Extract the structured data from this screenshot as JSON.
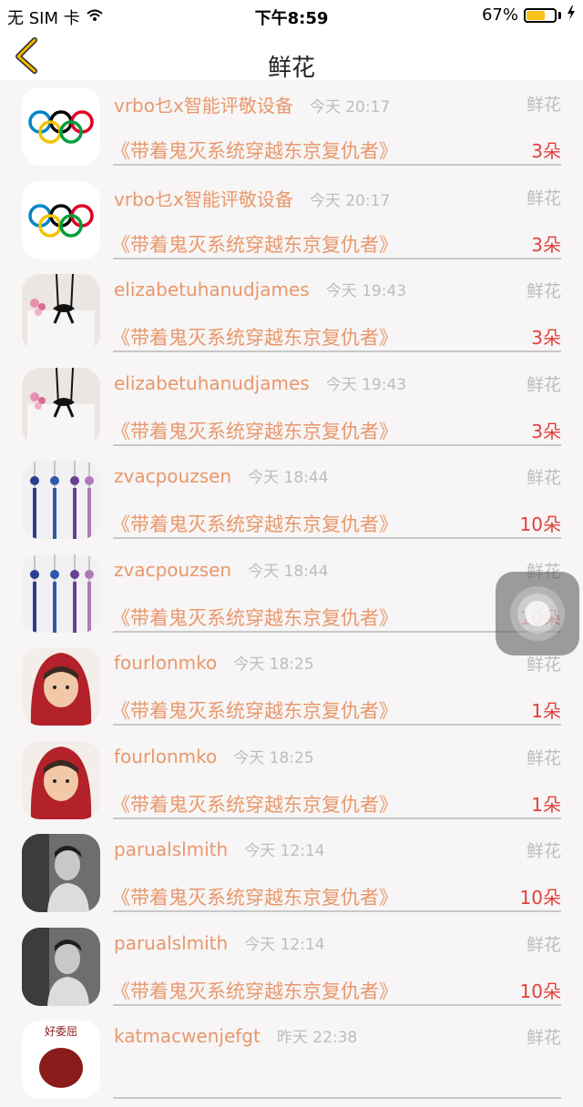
{
  "status": {
    "carrier": "无 SIM 卡",
    "time": "下午8:59",
    "battery": "67%",
    "battery_level": 0.67
  },
  "nav": {
    "title": "鲜花"
  },
  "items": [
    {
      "name": "vrbo乜x智能评敬设备",
      "time": "今天 20:17",
      "gift": "鲜花",
      "book": "《带着鬼灭系统穿越东京复仇者》",
      "count": "3朵",
      "avatar": "olympic-rings"
    },
    {
      "name": "vrbo乜x智能评敬设备",
      "time": "今天 20:17",
      "gift": "鲜花",
      "book": "《带着鬼灭系统穿越东京复仇者》",
      "count": "3朵",
      "avatar": "olympic-rings"
    },
    {
      "name": "elizabetuhanudjames",
      "time": "今天 19:43",
      "gift": "鲜花",
      "book": "《带着鬼灭系统穿越东京复仇者》",
      "count": "3朵",
      "avatar": "bag-flowers"
    },
    {
      "name": "elizabetuhanudjames",
      "time": "今天 19:43",
      "gift": "鲜花",
      "book": "《带着鬼灭系统穿越东京复仇者》",
      "count": "3朵",
      "avatar": "bag-flowers"
    },
    {
      "name": "zvacpouzsen",
      "time": "今天 18:44",
      "gift": "鲜花",
      "book": "《带着鬼灭系统穿越东京复仇者》",
      "count": "10朵",
      "avatar": "tassels"
    },
    {
      "name": "zvacpouzsen",
      "time": "今天 18:44",
      "gift": "鲜花",
      "book": "《带着鬼灭系统穿越东京复仇者》",
      "count": "10朵",
      "avatar": "tassels"
    },
    {
      "name": "fourlonmko",
      "time": "今天 18:25",
      "gift": "鲜花",
      "book": "《带着鬼灭系统穿越东京复仇者》",
      "count": "1朵",
      "avatar": "child-hood"
    },
    {
      "name": "fourlonmko",
      "time": "今天 18:25",
      "gift": "鲜花",
      "book": "《带着鬼灭系统穿越东京复仇者》",
      "count": "1朵",
      "avatar": "child-hood"
    },
    {
      "name": "parualslmith",
      "time": "今天 12:14",
      "gift": "鲜花",
      "book": "《带着鬼灭系统穿越东京复仇者》",
      "count": "10朵",
      "avatar": "man-bw"
    },
    {
      "name": "parualslmith",
      "time": "今天 12:14",
      "gift": "鲜花",
      "book": "《带着鬼灭系统穿越东京复仇者》",
      "count": "10朵",
      "avatar": "man-bw"
    },
    {
      "name": "katmacwenjefgt",
      "time": "昨天 22:38",
      "gift": "鲜花",
      "book": "",
      "count": "",
      "avatar": "logo-badge",
      "avatar_text": "好委屈"
    }
  ],
  "colors": {
    "name": "#e8986c",
    "count": "#e0413d",
    "muted": "#bdbdbd",
    "back": "#f2b600"
  }
}
